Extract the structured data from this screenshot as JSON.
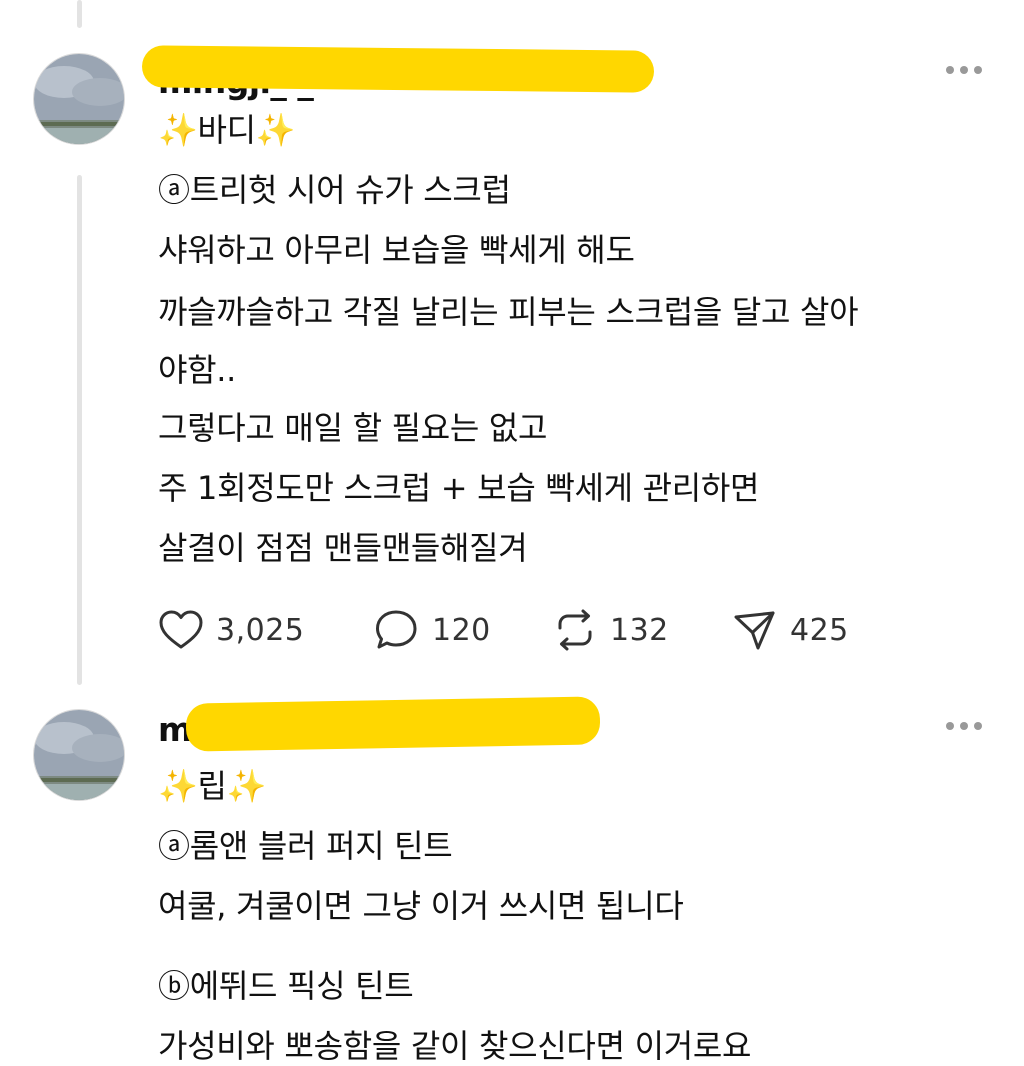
{
  "posts": [
    {
      "username": "mingji_ _",
      "title": "✨바디✨",
      "lines": [
        "ⓐ트리헛 시어 슈가 스크럽",
        "샤워하고 아무리 보습을 빡세게 해도",
        "까슬까슬하고 각질 날리는 피부는 스크럽을 달고 살아",
        "야함..",
        "그렇다고 매일 할 필요는 없고",
        "주 1회정도만 스크럽 + 보습 빡세게 관리하면",
        "살결이 점점 맨들맨들해질겨"
      ],
      "actions": {
        "likes": "3,025",
        "comments": "120",
        "reposts": "132",
        "shares": "425"
      }
    },
    {
      "username": "mingji_ _",
      "title": "✨립✨",
      "lines": [
        "ⓐ롬앤 블러 퍼지 틴트",
        "여쿨, 겨쿨이면 그냥 이거 쓰시면 됩니다",
        "",
        "ⓑ에뛰드 픽싱 틴트",
        "가성비와 뽀송함을 같이 찾으신다면 이거로요"
      ]
    }
  ],
  "colors": {
    "redaction": "#ffd700",
    "thread_line": "#e3e3e3",
    "icon": "#333333"
  }
}
